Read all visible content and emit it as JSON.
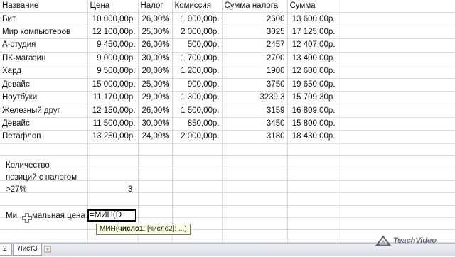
{
  "headers": [
    "Название",
    "Цена",
    "Налог",
    "Комиссия",
    "Сумма налога",
    "Сумма"
  ],
  "rows": [
    {
      "name": "Бит",
      "price": "10 000,00р.",
      "tax": "26,00%",
      "commission": "1 000,00р.",
      "tax_sum": "2600",
      "total": "13 600,00р."
    },
    {
      "name": "Мир компьютеров",
      "price": "12 100,00р.",
      "tax": "25,00%",
      "commission": "2 000,00р.",
      "tax_sum": "3025",
      "total": "17 125,00р."
    },
    {
      "name": "А-студия",
      "price": "9 450,00р.",
      "tax": "26,00%",
      "commission": "500,00р.",
      "tax_sum": "2457",
      "total": "12 407,00р."
    },
    {
      "name": "ПК-магазин",
      "price": "9 000,00р.",
      "tax": "30,00%",
      "commission": "1 700,00р.",
      "tax_sum": "2700",
      "total": "13 400,00р."
    },
    {
      "name": "Хард",
      "price": "9 500,00р.",
      "tax": "20,00%",
      "commission": "1 200,00р.",
      "tax_sum": "1900",
      "total": "12 600,00р."
    },
    {
      "name": "Девайс",
      "price": "15 000,00р.",
      "tax": "25,00%",
      "commission": "900,00р.",
      "tax_sum": "3750",
      "total": "19 650,00р."
    },
    {
      "name": "Ноутбуки",
      "price": "11 170,00р.",
      "tax": "29,00%",
      "commission": "1 300,00р.",
      "tax_sum": "3239,3",
      "total": "15 709,30р."
    },
    {
      "name": "Железный друг",
      "price": "12 150,00р.",
      "tax": "26,00%",
      "commission": "1 500,00р.",
      "tax_sum": "3159",
      "total": "16 809,00р."
    },
    {
      "name": "Девайс",
      "price": "11 500,00р.",
      "tax": "30,00%",
      "commission": "850,00р.",
      "tax_sum": "3450",
      "total": "15 800,00р."
    },
    {
      "name": "Петафлоп",
      "price": "13 250,00р.",
      "tax": "24,00%",
      "commission": "2 000,00р.",
      "tax_sum": "3180",
      "total": "18 430,00р."
    }
  ],
  "count_label": {
    "line1": "Количество",
    "line2": "позиций с налогом",
    "line3": ">27%"
  },
  "count_value": "3",
  "min_label_left": "Ми",
  "min_label_right": "мальная цена",
  "formula_text": "=МИН(D",
  "tooltip": {
    "func": "МИН(",
    "arg1": "число1",
    "rest": "; [число2]; ...)"
  },
  "sheet_tabs": {
    "left": "2",
    "active": "Лист3"
  },
  "logo_text": "TeachVideo",
  "icons": {
    "cursor": "cell-select-cross-icon",
    "logo": "teachvideo-logo-icon"
  }
}
